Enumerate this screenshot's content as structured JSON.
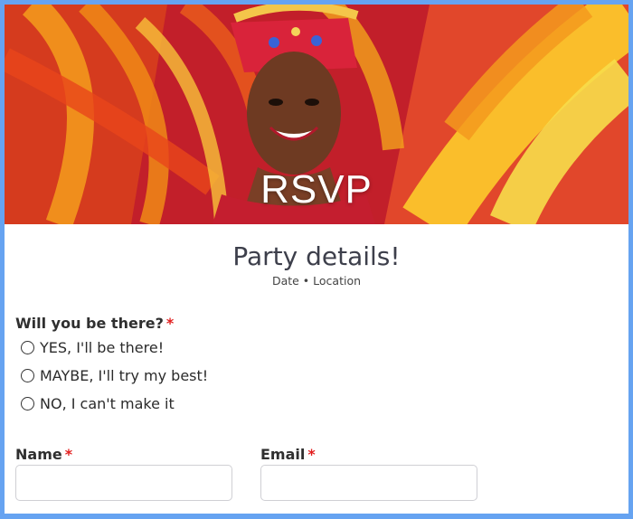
{
  "hero": {
    "title": "RSVP"
  },
  "header": {
    "title": "Party details!",
    "subtitle": "Date • Location"
  },
  "question": {
    "label": "Will you be there?",
    "required_mark": "*",
    "options": [
      {
        "label": "YES, I'll be there!"
      },
      {
        "label": "MAYBE, I'll try my best!"
      },
      {
        "label": "NO, I can't make it"
      }
    ]
  },
  "fields": {
    "name": {
      "label": "Name",
      "required_mark": "*",
      "value": "",
      "placeholder": ""
    },
    "email": {
      "label": "Email",
      "required_mark": "*",
      "value": "",
      "placeholder": ""
    }
  },
  "colors": {
    "frame_border": "#66a3f1",
    "required": "#e21f1f",
    "title_text": "#3d3f4b"
  }
}
